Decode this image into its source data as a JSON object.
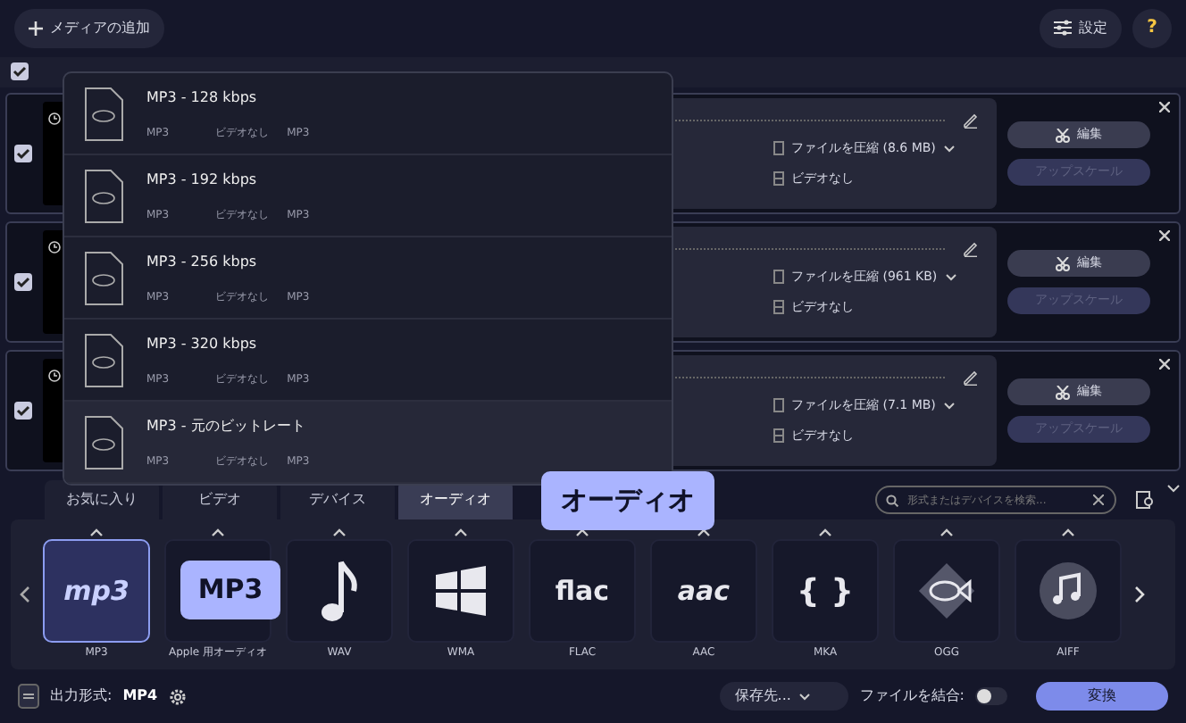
{
  "toolbar": {
    "add_media": "メディアの追加",
    "settings": "設定",
    "help": "?"
  },
  "selection_bar": {
    "checked": true
  },
  "files": [
    {
      "checked": true,
      "compress": "ファイルを圧縮 (8.6 MB)",
      "video": "ビデオなし",
      "edit": "編集",
      "upscale": "アップスケール",
      "upscale_disabled": true
    },
    {
      "checked": true,
      "compress": "ファイルを圧縮 (961 KB)",
      "video": "ビデオなし",
      "edit": "編集",
      "upscale": "アップスケール",
      "upscale_disabled": true
    },
    {
      "checked": true,
      "compress": "ファイルを圧縮 (7.1 MB)",
      "video": "ビデオなし",
      "edit": "編集",
      "upscale": "アップスケール",
      "upscale_disabled": true
    }
  ],
  "preset_menu": {
    "items": [
      {
        "title": "MP3 - 128 kbps",
        "format": "MP3",
        "video": "ビデオなし",
        "audio": "MP3",
        "selected": false
      },
      {
        "title": "MP3 - 192 kbps",
        "format": "MP3",
        "video": "ビデオなし",
        "audio": "MP3",
        "selected": false
      },
      {
        "title": "MP3 - 256 kbps",
        "format": "MP3",
        "video": "ビデオなし",
        "audio": "MP3",
        "selected": false
      },
      {
        "title": "MP3 - 320 kbps",
        "format": "MP3",
        "video": "ビデオなし",
        "audio": "MP3",
        "selected": false
      },
      {
        "title": "MP3 - 元のビットレート",
        "format": "MP3",
        "video": "ビデオなし",
        "audio": "MP3",
        "selected": true
      }
    ]
  },
  "format_tabs": [
    {
      "label": "お気に入り",
      "selected": false
    },
    {
      "label": "ビデオ",
      "selected": false
    },
    {
      "label": "デバイス",
      "selected": false
    },
    {
      "label": "オーディオ",
      "selected": true
    }
  ],
  "tab_tooltip": "オーディオ",
  "search": {
    "placeholder": "形式またはデバイスを検索..."
  },
  "formats": [
    {
      "label": "MP3",
      "kind": "mp3",
      "logo_text": "mp3",
      "selected": true
    },
    {
      "label": "Apple 用オーディオ",
      "kind": "apple",
      "selected": false
    },
    {
      "label": "WAV",
      "kind": "note",
      "selected": false
    },
    {
      "label": "WMA",
      "kind": "windows",
      "selected": false
    },
    {
      "label": "FLAC",
      "kind": "flac",
      "logo_text": "flac",
      "selected": false
    },
    {
      "label": "AAC",
      "kind": "aac",
      "logo_text": "aac",
      "selected": false
    },
    {
      "label": "MKA",
      "kind": "braces",
      "logo_text": "{ }",
      "selected": false
    },
    {
      "label": "OGG",
      "kind": "fish",
      "selected": false
    },
    {
      "label": "AIFF",
      "kind": "circle-note",
      "selected": false
    }
  ],
  "format_tooltip": "MP3",
  "bottom": {
    "output_label": "出力形式:",
    "output_value": "MP4",
    "save_to": "保存先...",
    "merge_label": "ファイルを結合:",
    "merge_on": false,
    "convert": "変換"
  }
}
